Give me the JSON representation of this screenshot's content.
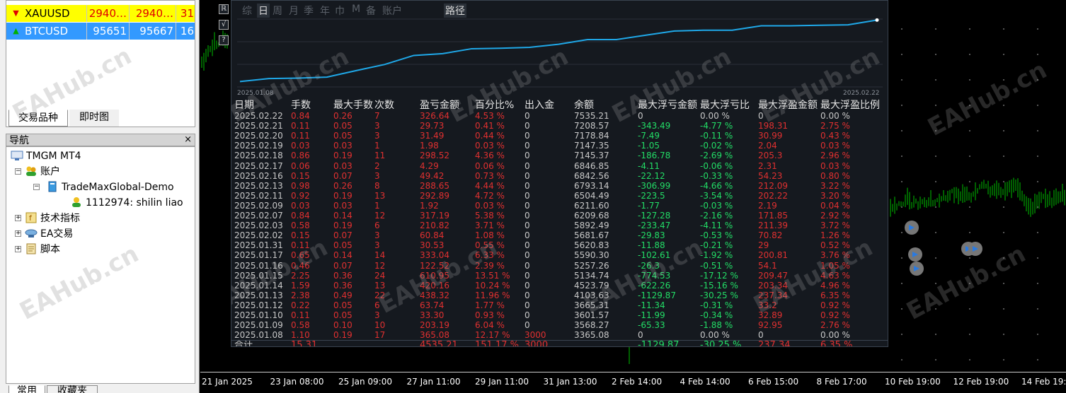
{
  "market_watch": {
    "rows": [
      {
        "symbol": "XAUUSD",
        "bid": "2940…",
        "ask": "2940…",
        "spread": "31",
        "direction": "down-arrow-icon"
      },
      {
        "symbol": "BTCUSD",
        "bid": "95651",
        "ask": "95667",
        "spread": "16",
        "direction": "up-arrow-icon"
      }
    ],
    "tabs": [
      "交易品种",
      "即时图"
    ]
  },
  "navigator": {
    "title": "导航",
    "close": "×",
    "items": [
      {
        "label": "TMGM MT4"
      },
      {
        "label": "账户"
      },
      {
        "label": "TradeMaxGlobal-Demo"
      },
      {
        "label": "1112974: shilin liao"
      },
      {
        "label": "技术指标"
      },
      {
        "label": "EA交易"
      },
      {
        "label": "脚本"
      }
    ],
    "bottom_tabs": [
      "常用",
      "收藏夹"
    ]
  },
  "report": {
    "toolbar": [
      "综",
      "日",
      "周",
      "月",
      "季",
      "年",
      "巾",
      "M",
      "备",
      "账户",
      "路径"
    ],
    "side_buttons": [
      "ℝ",
      "√",
      "?"
    ],
    "curve_start_date": "2025.01.08",
    "curve_end_date": "2025.02.22",
    "curve_values": [
      3365.08,
      3568.27,
      3601.57,
      3665.31,
      4103.63,
      4523.79,
      5134.74,
      5257.26,
      5590.3,
      5620.83,
      5681.67,
      5892.49,
      6209.68,
      6211.6,
      6504.49,
      6793.14,
      6842.56,
      6846.85,
      7145.37,
      7147.35,
      7178.84,
      7208.57,
      7535.21
    ],
    "headers": [
      "日期",
      "手数",
      "最大手数",
      "次数",
      "盈亏金额",
      "百分比%",
      "出入金",
      "余额",
      "最大浮亏金额",
      "最大浮亏比",
      "最大浮盈金额",
      "最大浮盈比例"
    ],
    "rows": [
      [
        "2025.02.22",
        "0.84",
        "0.26",
        "7",
        "326.64",
        "4.53 %",
        "0",
        "7535.21",
        "0",
        "0.00 %",
        "0",
        "0.00 %"
      ],
      [
        "2025.02.21",
        "0.11",
        "0.05",
        "3",
        "29.73",
        "0.41 %",
        "0",
        "7208.57",
        "-343.49",
        "-4.77 %",
        "198.31",
        "2.75 %"
      ],
      [
        "2025.02.20",
        "0.11",
        "0.05",
        "3",
        "31.49",
        "0.44 %",
        "0",
        "7178.84",
        "-7.49",
        "-0.11 %",
        "30.99",
        "0.43 %"
      ],
      [
        "2025.02.19",
        "0.03",
        "0.03",
        "1",
        "1.98",
        "0.03 %",
        "0",
        "7147.35",
        "-1.05",
        "-0.02 %",
        "2.04",
        "0.03 %"
      ],
      [
        "2025.02.18",
        "0.86",
        "0.19",
        "11",
        "298.52",
        "4.36 %",
        "0",
        "7145.37",
        "-186.78",
        "-2.69 %",
        "205.3",
        "2.96 %"
      ],
      [
        "2025.02.17",
        "0.06",
        "0.03",
        "2",
        "4.29",
        "0.06 %",
        "0",
        "6846.85",
        "-4.11",
        "-0.06 %",
        "2.31",
        "0.03 %"
      ],
      [
        "2025.02.16",
        "0.15",
        "0.07",
        "3",
        "49.42",
        "0.73 %",
        "0",
        "6842.56",
        "-22.12",
        "-0.33 %",
        "54.23",
        "0.80 %"
      ],
      [
        "2025.02.13",
        "0.98",
        "0.26",
        "8",
        "288.65",
        "4.44 %",
        "0",
        "6793.14",
        "-306.99",
        "-4.66 %",
        "212.09",
        "3.22 %"
      ],
      [
        "2025.02.11",
        "0.92",
        "0.19",
        "13",
        "292.89",
        "4.72 %",
        "0",
        "6504.49",
        "-223.5",
        "-3.54 %",
        "202.22",
        "3.20 %"
      ],
      [
        "2025.02.09",
        "0.03",
        "0.03",
        "1",
        "1.92",
        "0.03 %",
        "0",
        "6211.60",
        "-1.77",
        "-0.03 %",
        "2.19",
        "0.04 %"
      ],
      [
        "2025.02.07",
        "0.84",
        "0.14",
        "12",
        "317.19",
        "5.38 %",
        "0",
        "6209.68",
        "-127.28",
        "-2.16 %",
        "171.85",
        "2.92 %"
      ],
      [
        "2025.02.03",
        "0.58",
        "0.19",
        "6",
        "210.82",
        "3.71 %",
        "0",
        "5892.49",
        "-233.47",
        "-4.11 %",
        "211.39",
        "3.72 %"
      ],
      [
        "2025.02.02",
        "0.15",
        "0.07",
        "3",
        "60.84",
        "1.08 %",
        "0",
        "5681.67",
        "-29.83",
        "-0.53 %",
        "70.82",
        "1.26 %"
      ],
      [
        "2025.01.31",
        "0.11",
        "0.05",
        "3",
        "30.53",
        "0.55 %",
        "0",
        "5620.83",
        "-11.88",
        "-0.21 %",
        "29",
        "0.52 %"
      ],
      [
        "2025.01.17",
        "0.65",
        "0.14",
        "14",
        "333.04",
        "6.33 %",
        "0",
        "5590.30",
        "-102.61",
        "-1.92 %",
        "200.81",
        "3.76 %"
      ],
      [
        "2025.01.16",
        "0.46",
        "0.07",
        "12",
        "122.52",
        "2.39 %",
        "0",
        "5257.26",
        "-26.3",
        "-0.51 %",
        "54.1",
        "1.05 %"
      ],
      [
        "2025.01.15",
        "2.25",
        "0.36",
        "24",
        "610.95",
        "13.51 %",
        "0",
        "5134.74",
        "-774.53",
        "-17.12 %",
        "209.47",
        "4.63 %"
      ],
      [
        "2025.01.14",
        "1.59",
        "0.36",
        "13",
        "420.16",
        "10.24 %",
        "0",
        "4523.79",
        "-622.26",
        "-15.16 %",
        "203.34",
        "4.96 %"
      ],
      [
        "2025.01.13",
        "2.38",
        "0.49",
        "22",
        "438.32",
        "11.96 %",
        "0",
        "4103.63",
        "-1129.87",
        "-30.25 %",
        "237.34",
        "6.35 %"
      ],
      [
        "2025.01.12",
        "0.22",
        "0.05",
        "6",
        "63.74",
        "1.77 %",
        "0",
        "3665.31",
        "-11.34",
        "-0.31 %",
        "33.2",
        "0.92 %"
      ],
      [
        "2025.01.10",
        "0.11",
        "0.05",
        "3",
        "33.30",
        "0.93 %",
        "0",
        "3601.57",
        "-11.99",
        "-0.34 %",
        "32.89",
        "0.92 %"
      ],
      [
        "2025.01.09",
        "0.58",
        "0.10",
        "10",
        "203.19",
        "6.04 %",
        "0",
        "3568.27",
        "-65.33",
        "-1.88 %",
        "92.95",
        "2.76 %"
      ],
      [
        "2025.01.08",
        "1.10",
        "0.19",
        "17",
        "365.08",
        "12.17 %",
        "3000",
        "3365.08",
        "0",
        "0.00 %",
        "0",
        "0.00 %"
      ]
    ],
    "total": {
      "label": "合计",
      "lots": "15.31",
      "profit": "4535.21",
      "percent": "151.17 %",
      "deposit": "3000",
      "max_float_loss": "-1129.87",
      "max_float_loss_pct": "-30.25 %",
      "max_float_profit": "237.34",
      "max_float_profit_pct": "6.35 %"
    }
  },
  "time_axis": [
    "21 Jan 2025",
    "23 Jan 08:00",
    "25 Jan 09:00",
    "27 Jan 11:00",
    "29 Jan 11:00",
    "31 Jan 13:00",
    "2 Feb 14:00",
    "4 Feb 14:00",
    "6 Feb 15:00",
    "8 Feb 17:00",
    "10 Feb 19:00",
    "12 Feb 19:00",
    "14 Feb 19:00"
  ],
  "watermark": "EAHub.cn",
  "colors": {
    "positive": "#e03030",
    "negative": "#22dd66",
    "curve": "#1fa8e8",
    "candle": "#00c000"
  }
}
